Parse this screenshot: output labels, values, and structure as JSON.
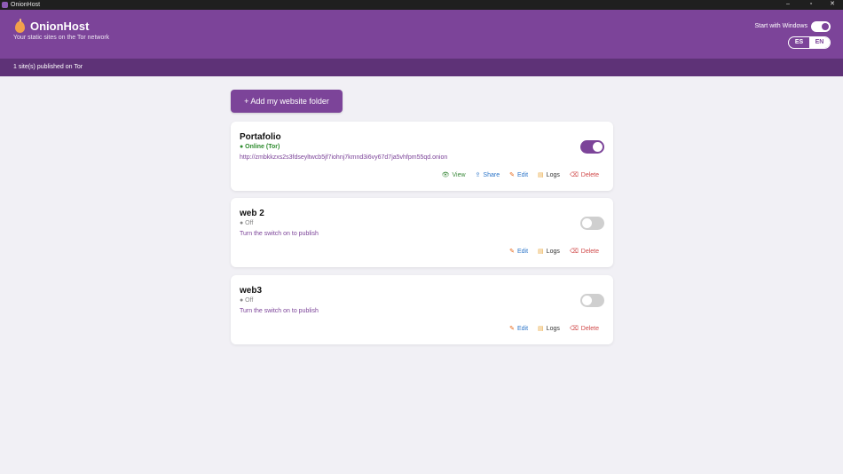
{
  "window": {
    "title": "OnionHost",
    "minimize": "–",
    "maximize": "▫",
    "close": "✕"
  },
  "header": {
    "app_name": "OnionHost",
    "tagline": "Your static sites on the Tor network",
    "startup_label": "Start with Windows",
    "startup_enabled": true,
    "lang_es": "ES",
    "lang_en": "EN",
    "lang_selected": "EN"
  },
  "status_bar": {
    "text": "1 site(s) published on Tor"
  },
  "main": {
    "add_button": "+ Add my website folder"
  },
  "sites": [
    {
      "name": "Portafolio",
      "status": "● Online (Tor)",
      "detail": "http://zmbkkzxs2s3fdseyltwcb5jf7iohnj7kmnd3i6vy67d7ja5vhfpm55qd.onion",
      "enabled": true,
      "actions": {
        "view": "View",
        "share": "Share",
        "edit": "Edit",
        "logs": "Logs",
        "delete": "Delete"
      }
    },
    {
      "name": "web 2",
      "status": "● Off",
      "detail": "Turn the switch on to publish",
      "enabled": false,
      "actions": {
        "edit": "Edit",
        "logs": "Logs",
        "delete": "Delete"
      }
    },
    {
      "name": "web3",
      "status": "● Off",
      "detail": "Turn the switch on to publish",
      "enabled": false,
      "actions": {
        "edit": "Edit",
        "logs": "Logs",
        "delete": "Delete"
      }
    }
  ],
  "icons": {
    "view": "eye-icon",
    "share": "share-icon",
    "edit": "pencil-icon",
    "logs": "scroll-icon",
    "delete": "trash-icon"
  },
  "colors": {
    "brand": "#7c4499",
    "status_bar": "#5e3277",
    "online": "#2e8b2e",
    "delete": "#d04848",
    "link": "#2b74c8"
  }
}
